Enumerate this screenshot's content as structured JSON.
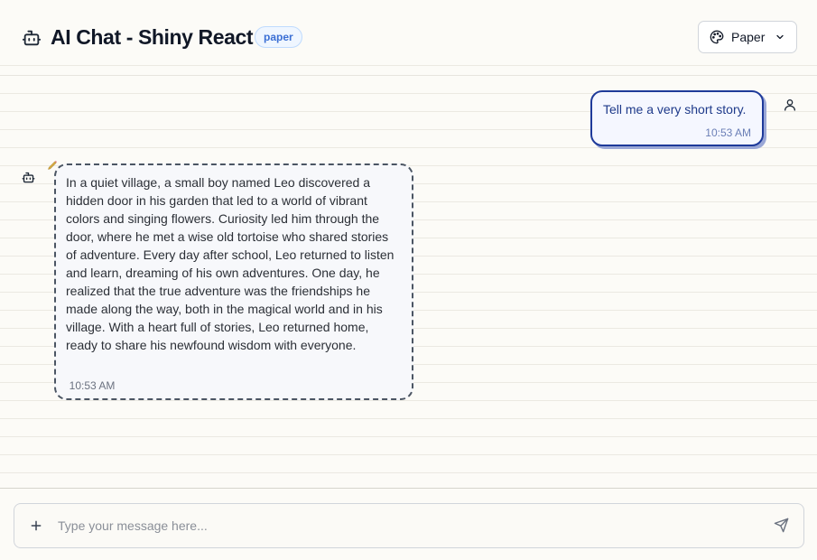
{
  "header": {
    "title": "AI Chat - Shiny React",
    "badge": "paper",
    "icon": "robot-icon",
    "theme_selector": {
      "selected": "Paper",
      "icon": "palette-icon"
    }
  },
  "messages": [
    {
      "role": "user",
      "text": "Tell me a very short story.",
      "time": "10:53 AM",
      "avatar_icon": "user-icon"
    },
    {
      "role": "assistant",
      "text": "In a quiet village, a small boy named Leo discovered a hidden door in his garden that led to a world of vibrant colors and singing flowers. Curiosity led him through the door, where he met a wise old tortoise who shared stories of adventure. Every day after school, Leo returned to listen and learn, dreaming of his own adventures. One day, he realized that the true adventure was the friendships he made along the way, both in the magical world and in his village. With a heart full of stories, Leo returned home, ready to share his newfound wisdom with everyone.",
      "time": "10:53 AM",
      "avatar_icon": "robot-icon"
    }
  ],
  "composer": {
    "placeholder": "Type your message here...",
    "value": ""
  },
  "colors": {
    "accent": "#1e3a9a",
    "badge_text": "#3b6fd4",
    "background": "#fcfbf7"
  }
}
